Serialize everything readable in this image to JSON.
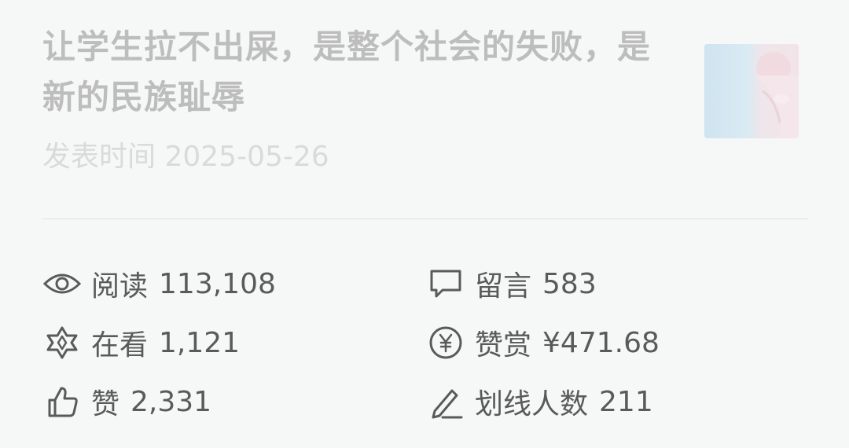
{
  "article": {
    "title": "让学生拉不出屎，是整个社会的失败，是新的民族耻辱",
    "publish_label": "发表时间",
    "publish_date": "2025-05-26",
    "thumbnail_icon": "article-thumbnail"
  },
  "stats": {
    "reads": {
      "label": "阅读",
      "value": "113,108",
      "icon": "eye-icon"
    },
    "comments": {
      "label": "留言",
      "value": "583",
      "icon": "comment-icon"
    },
    "watching": {
      "label": "在看",
      "value": "1,121",
      "icon": "star-icon"
    },
    "tips": {
      "label": "赞赏",
      "value": "¥471.68",
      "icon": "yuan-icon"
    },
    "likes": {
      "label": "赞",
      "value": "2,331",
      "icon": "thumbs-up-icon"
    },
    "highlights": {
      "label": "划线人数",
      "value": "211",
      "icon": "pen-icon"
    }
  },
  "colors": {
    "background": "#f6f7f7",
    "title_text": "#bdbdbd",
    "date_text": "#dadada",
    "stat_text": "#5a5a5a"
  }
}
